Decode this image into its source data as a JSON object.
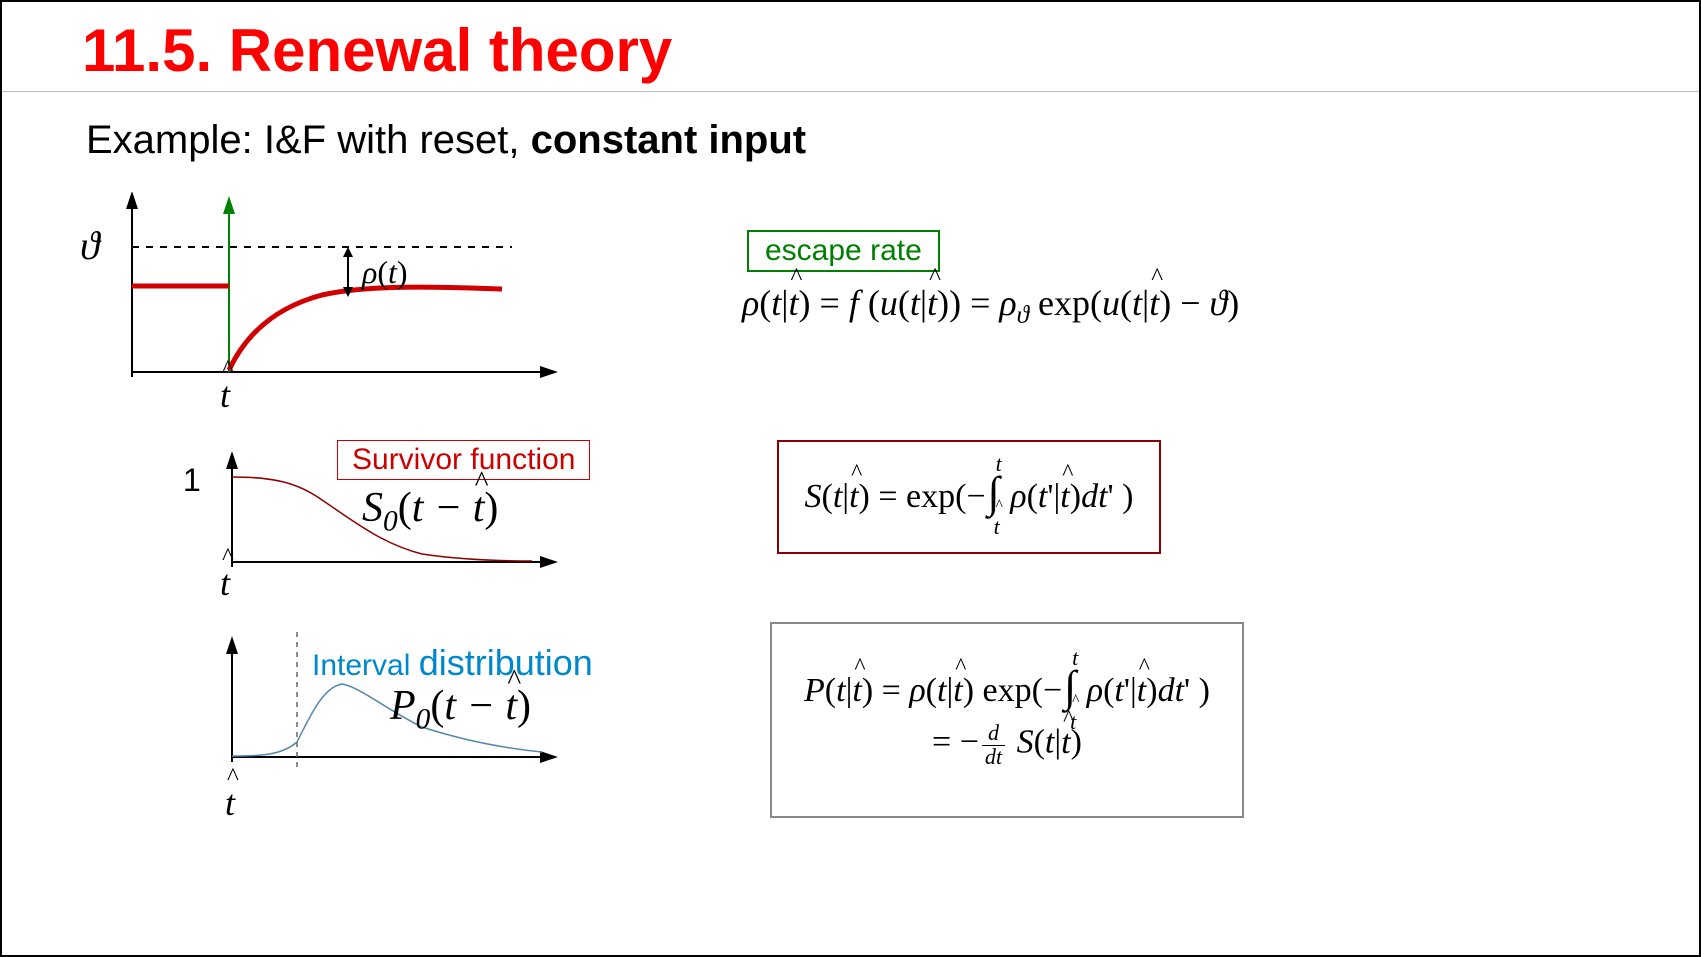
{
  "title": "11.5.  Renewal theory",
  "subtitle_prefix": "Example: I&F with reset, ",
  "subtitle_bold": "constant input",
  "labels": {
    "escape_rate": "escape rate",
    "survivor_function": "Survivor function",
    "interval_prefix": "Interval ",
    "interval_big": "distribution",
    "theta": "ϑ",
    "one": "1",
    "that": "t̂",
    "rho_t": "ρ(t)"
  },
  "equations": {
    "escape": "ρ(t|t̂) = f(u(t|t̂)) = ρ_ϑ exp(u(t|t̂) − ϑ)",
    "S0": "S₀(t − t̂)",
    "survivor": "S(t|t̂) = exp(−∫_{t̂}^{t} ρ(t'|t̂) dt')",
    "P0": "P₀(t − t̂)",
    "interval_line1": "P(t|t̂) = ρ(t|t̂) exp(−∫_{t̂}^{t} ρ(t'|t̂) dt')",
    "interval_line2": "= −(d/dt) S(t|t̂)"
  },
  "chart_data": [
    {
      "type": "line",
      "name": "membrane-potential",
      "title": "",
      "xlabel": "t̂",
      "ylabel": "ϑ",
      "x": [
        -1,
        0,
        0.05,
        0.2,
        0.5,
        1.0,
        1.6,
        2.2,
        2.8
      ],
      "y": [
        0.68,
        0.68,
        0.02,
        0.25,
        0.45,
        0.56,
        0.63,
        0.67,
        0.7
      ],
      "series": [
        {
          "name": "threshold_theta",
          "style": "dashed",
          "y_const": 1.0,
          "color": "#000"
        },
        {
          "name": "u(t)",
          "color": "#d00000"
        }
      ],
      "annotations": [
        "ρ(t) distance arrow between u(t) and threshold",
        "green vertical marker at t̂"
      ],
      "xlim": [
        -1,
        3
      ],
      "ylim": [
        0,
        1.1
      ]
    },
    {
      "type": "line",
      "name": "survivor-function",
      "title": "Survivor function",
      "series_name": "S₀(t − t̂)",
      "xlabel": "t̂",
      "ylabel": "",
      "y_at_origin": 1,
      "x": [
        0,
        0.3,
        0.6,
        1.0,
        1.4,
        1.8,
        2.2,
        2.6,
        3.0
      ],
      "y": [
        1.0,
        0.98,
        0.9,
        0.68,
        0.4,
        0.2,
        0.09,
        0.04,
        0.02
      ],
      "xlim": [
        0,
        3
      ],
      "ylim": [
        0,
        1.05
      ],
      "color": "#8b0000"
    },
    {
      "type": "line",
      "name": "interval-distribution",
      "title": "Interval distribution",
      "series_name": "P₀(t − t̂)",
      "xlabel": "t̂",
      "ylabel": "",
      "x": [
        0,
        0.3,
        0.55,
        0.75,
        0.95,
        1.1,
        1.4,
        2.0,
        2.5,
        3.0
      ],
      "y": [
        0,
        0.01,
        0.05,
        0.4,
        0.85,
        1.0,
        0.78,
        0.4,
        0.22,
        0.1
      ],
      "xlim": [
        0,
        3
      ],
      "ylim": [
        0,
        1.05
      ],
      "color": "#5588aa",
      "annotations": [
        "vertical dashed reference at x≈0.55"
      ]
    }
  ]
}
